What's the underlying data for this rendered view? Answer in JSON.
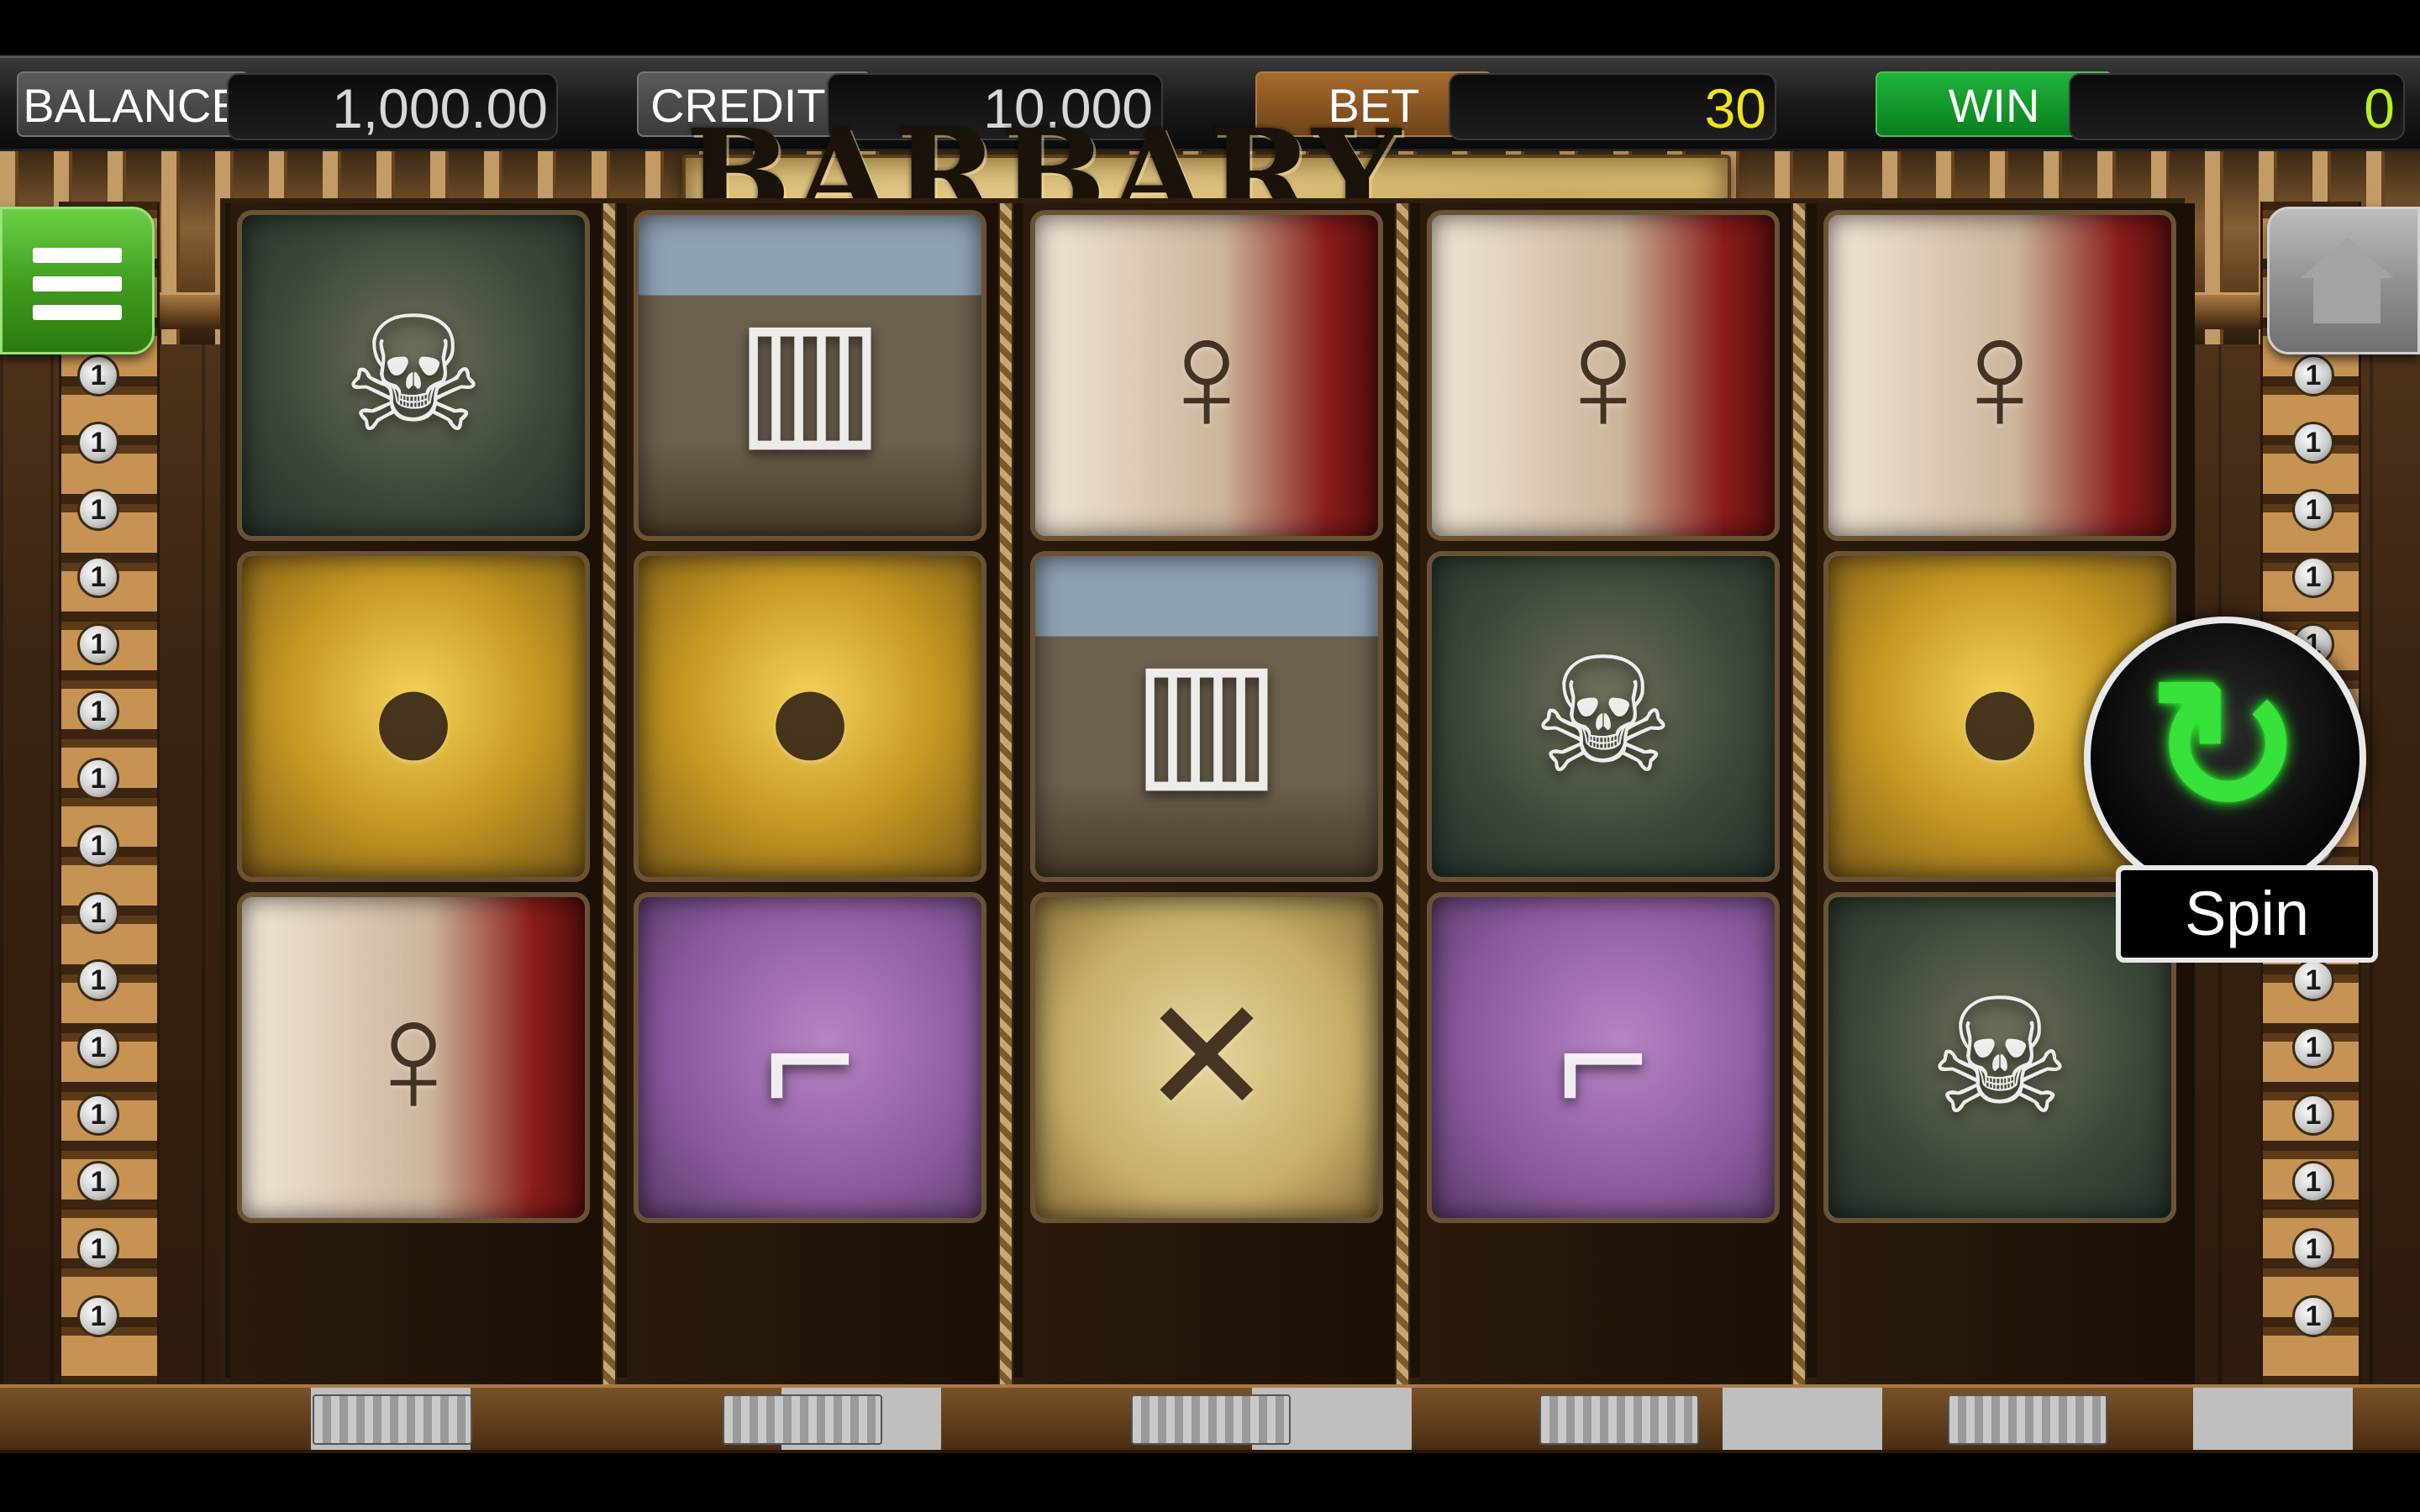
{
  "topbar": {
    "balance": {
      "label": "BALANCE",
      "value": "1,000.00"
    },
    "credits": {
      "label": "CREDITS",
      "value": "10,000"
    },
    "bet": {
      "label": "BET",
      "value": "30"
    },
    "win": {
      "label": "WIN",
      "value": "0"
    }
  },
  "title": "BARBARY COAST",
  "spin": {
    "label": "Spin"
  },
  "paylines": {
    "left": [
      "1",
      "1",
      "1",
      "1",
      "1",
      "1",
      "1",
      "1",
      "1",
      "1",
      "1",
      "1",
      "1",
      "1",
      "1",
      "1",
      "1"
    ],
    "right": [
      "1",
      "1",
      "1",
      "1",
      "1",
      "1",
      "1",
      "1",
      "1",
      "1",
      "1",
      "1",
      "1",
      "1",
      "1",
      "1",
      "1"
    ]
  },
  "reels": [
    [
      "skull-swords",
      "gold-coins",
      "lady"
    ],
    [
      "barrel",
      "gold-coins",
      "pistol"
    ],
    [
      "lady",
      "barrel",
      "treasure-map"
    ],
    [
      "lady",
      "skull-swords",
      "pistol"
    ],
    [
      "lady",
      "gold-coins",
      "skull-swords"
    ]
  ],
  "symbol_icons": {
    "skull-swords": "☠",
    "gold-coins": "●",
    "lady": "♀",
    "barrel": "▥",
    "pistol": "⌐",
    "treasure-map": "✕"
  },
  "colors": {
    "bet_accent": "#a7692e",
    "win_accent": "#1fb43a",
    "bet_value": "#f3e31a",
    "win_value": "#b6f21b",
    "spin_glow": "#37e23a"
  }
}
